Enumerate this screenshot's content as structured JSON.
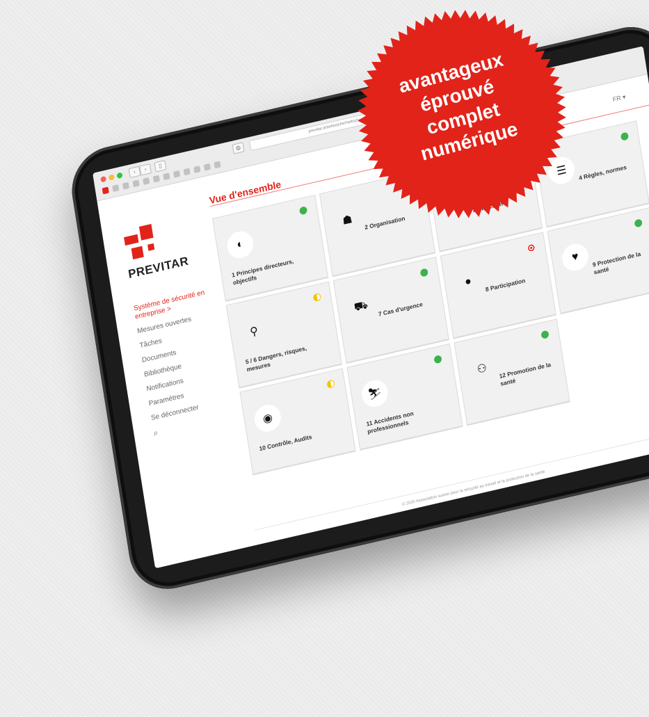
{
  "badge": {
    "color": "#e2231a",
    "lines": [
      "avantageux",
      "éprouvé",
      "complet",
      "numérique"
    ]
  },
  "browser": {
    "url": "previtar.arbeitssicherheitschweiz.ch/de/ubersicht"
  },
  "header": {
    "language": "FR ▾"
  },
  "sidebar": {
    "brand": "PREVITAR",
    "items": [
      {
        "label": "Système de sécurité en entreprise  >",
        "active": true
      },
      {
        "label": "Mesures ouvertes",
        "active": false
      },
      {
        "label": "Tâches",
        "active": false
      },
      {
        "label": "Documents",
        "active": false
      },
      {
        "label": "Bibliothèque",
        "active": false
      },
      {
        "label": "Notifications",
        "active": false
      },
      {
        "label": "Paramètres",
        "active": false
      },
      {
        "label": "Se déconnecter",
        "active": false
      }
    ],
    "search_icon": "search-icon"
  },
  "main": {
    "title": "Vue d'ensemble",
    "tiles": [
      {
        "label": "1 Principes directeurs, objectifs",
        "icon": "compass-icon",
        "status": "green"
      },
      {
        "label": "2 Organisation",
        "icon": "org-chart-icon",
        "status": "green"
      },
      {
        "label": "3 Formation, instruction",
        "icon": "book-reader-icon",
        "status": "yellow"
      },
      {
        "label": "4 Règles, normes",
        "icon": "checklist-icon",
        "status": "green"
      },
      {
        "label": "5 / 6 Dangers, risques, mesures",
        "icon": "magnifier-icon",
        "status": "yellow"
      },
      {
        "label": "7 Cas d'urgence",
        "icon": "ambulance-icon",
        "status": "green"
      },
      {
        "label": "8 Participation",
        "icon": "chat-bubbles-icon",
        "status": "target"
      },
      {
        "label": "9 Protection de la santé",
        "icon": "heartbeat-icon",
        "status": "green"
      },
      {
        "label": "10 Contrôle, Audits",
        "icon": "eye-icon",
        "status": "yellow"
      },
      {
        "label": "11 Accidents non professionnels",
        "icon": "skier-icon",
        "status": "green"
      },
      {
        "label": "12 Promotion de la santé",
        "icon": "people-icon",
        "status": "green"
      }
    ]
  },
  "footer": {
    "text": "© 2020 Association suisse pour la sécurité au travail et la protection de la santé"
  }
}
